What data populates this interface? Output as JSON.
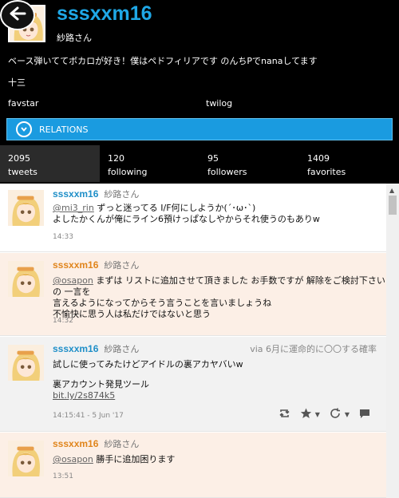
{
  "profile": {
    "screen_name": "sssxxm16",
    "display_name": "紗路さん",
    "bio": "ベース弾いててボカロが好き！僕はペドフィリアです のんちPでnanaしてます",
    "location": "十三",
    "links": {
      "favstar": "favstar",
      "twilog": "twilog"
    }
  },
  "relations": {
    "label": "RELATIONS"
  },
  "stats": [
    {
      "count": "2095",
      "label": "tweets"
    },
    {
      "count": "120",
      "label": "following"
    },
    {
      "count": "95",
      "label": "followers"
    },
    {
      "count": "1409",
      "label": "favorites"
    }
  ],
  "tweets": [
    {
      "screen_name": "sssxxm16",
      "display_name": "紗路さん",
      "mention": "@mi3_rin",
      "line1": " ずっと迷ってる I/F何にしようか(´･ω･`)",
      "line2": "よしたかくんが俺にライン6預けっぱなしやからそれ使うのもありw",
      "time": "14:33"
    },
    {
      "screen_name": "sssxxm16",
      "display_name": "紗路さん",
      "mention": "@osapon",
      "line1": " まずは リストに追加させて頂きました お手数ですが 解除をご検討下さいの 一言を",
      "line2": "言えるようになってからそう言うことを言いましょうね",
      "line3": "不愉快に思う人は私だけではないと思う",
      "time": "14:32"
    },
    {
      "screen_name": "sssxxm16",
      "display_name": "紗路さん",
      "via": "via  6月に運命的に〇〇する確率",
      "line1": "試しに使ってみたけどアイドルの裏アカヤバいw",
      "line2": "裏アカウント発見ツール",
      "link": "bit.ly/2s874k5",
      "time": "14:15:41 - 5 Jun '17"
    },
    {
      "screen_name": "sssxxm16",
      "display_name": "紗路さん",
      "mention": "@osapon",
      "line1": " 勝手に追加困ります",
      "time": "13:51"
    }
  ],
  "icons": [
    "back-arrow-icon",
    "relations-arrow-icon",
    "retweet-icon",
    "favorite-star-icon",
    "reply-icon",
    "scroll-up-icon"
  ],
  "colors": {
    "accent": "#1a9be0",
    "screen_name": "#1fa7e6",
    "highlight_bg": "#fcefe6",
    "orange_name": "#e0851c"
  }
}
